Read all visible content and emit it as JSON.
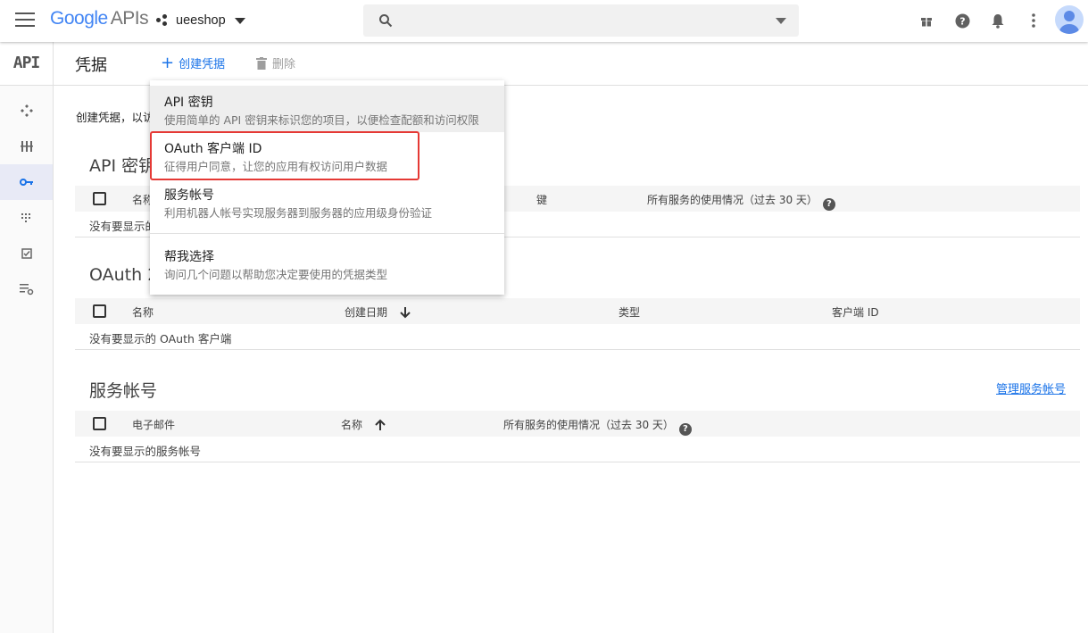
{
  "topbar": {
    "logo_google": "Google",
    "logo_apis": "APIs",
    "project_name": "ueeshop",
    "search_placeholder": ""
  },
  "rail": {
    "title": "API"
  },
  "header": {
    "title": "凭据",
    "create": "创建凭据",
    "delete": "删除"
  },
  "intro": "创建凭据，以访",
  "dropdown": {
    "items": [
      {
        "title": "API 密钥",
        "desc": "使用简单的 API 密钥来标识您的项目，以便检查配额和访问权限"
      },
      {
        "title": "OAuth 客户端 ID",
        "desc": "征得用户同意，让您的应用有权访问用户数据"
      },
      {
        "title": "服务帐号",
        "desc": "利用机器人帐号实现服务器到服务器的应用级身份验证"
      },
      {
        "title": "帮我选择",
        "desc": "询问几个问题以帮助您决定要使用的凭据类型"
      }
    ]
  },
  "api_keys": {
    "title": "API 密钥",
    "columns": [
      "名称",
      "键",
      "所有服务的使用情况（过去 30 天）"
    ],
    "empty": "没有要显示的"
  },
  "oauth": {
    "title": "OAuth 2",
    "columns": [
      "名称",
      "创建日期",
      "类型",
      "客户端 ID"
    ],
    "empty": "没有要显示的 OAuth 客户端"
  },
  "service_accounts": {
    "title": "服务帐号",
    "manage": "管理服务帐号",
    "columns": [
      "电子邮件",
      "名称",
      "所有服务的使用情况（过去 30 天）"
    ],
    "empty": "没有要显示的服务帐号"
  },
  "colors": {
    "accent": "#1a73e8",
    "highlight": "#e53935"
  }
}
